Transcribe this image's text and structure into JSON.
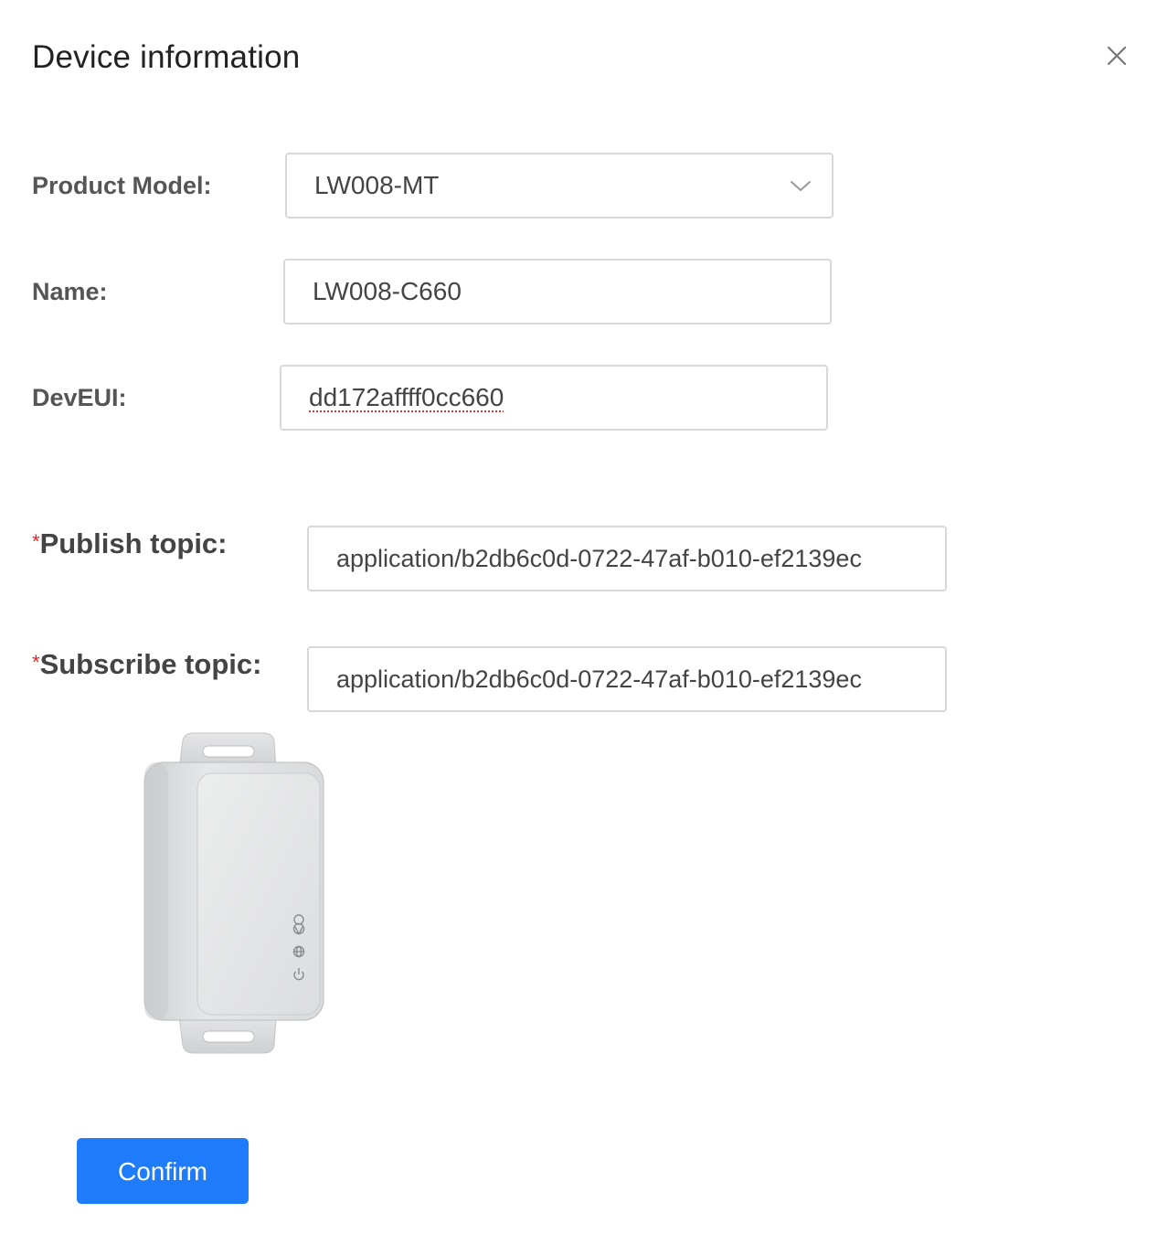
{
  "dialog": {
    "title": "Device information",
    "close_icon": "close-icon"
  },
  "form": {
    "product_model": {
      "label": "Product Model:",
      "value": "LW008-MT",
      "icon": "chevron-down-icon"
    },
    "name": {
      "label": "Name:",
      "value": "LW008-C660"
    },
    "dev_eui": {
      "label": "DevEUI:",
      "value": "dd172affff0cc660"
    },
    "publish_topic": {
      "required_mark": "*",
      "label": "Publish topic:",
      "value": "application/b2db6c0d-0722-47af-b010-ef2139ec"
    },
    "subscribe_topic": {
      "required_mark": "*",
      "label": "Subscribe topic:",
      "value": "application/b2db6c0d-0722-47af-b010-ef2139ec"
    }
  },
  "device_image": {
    "icons": [
      "location-pin-icon",
      "globe-icon",
      "power-icon"
    ]
  },
  "actions": {
    "confirm_label": "Confirm"
  },
  "colors": {
    "primary": "#1e7cfb",
    "required": "#e0262a",
    "border": "#d8d8d8"
  }
}
